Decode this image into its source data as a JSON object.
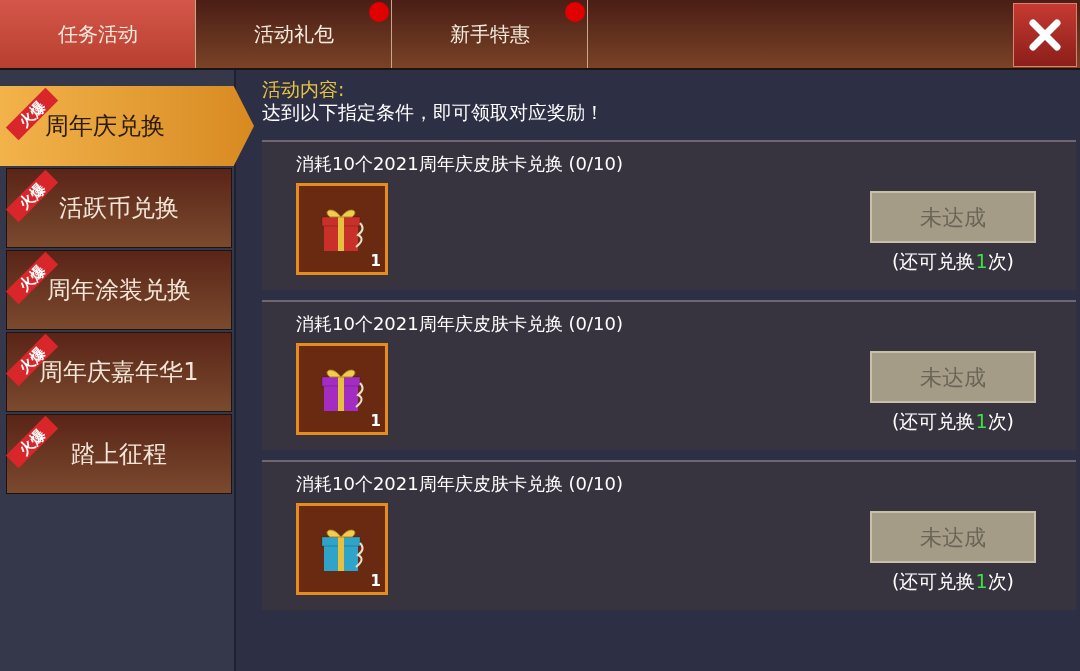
{
  "tabs": [
    {
      "label": "任务活动",
      "selected": true,
      "badge": false
    },
    {
      "label": "活动礼包",
      "selected": false,
      "badge": true
    },
    {
      "label": "新手特惠",
      "selected": false,
      "badge": true
    }
  ],
  "sidebar": {
    "items": [
      {
        "label": "周年庆兑换",
        "tag": "火爆",
        "selected": true
      },
      {
        "label": "活跃币兑换",
        "tag": "火爆",
        "selected": false
      },
      {
        "label": "周年涂装兑换",
        "tag": "火爆",
        "selected": false
      },
      {
        "label": "周年庆嘉年华1",
        "tag": "火爆",
        "selected": false
      },
      {
        "label": "踏上征程",
        "tag": "火爆",
        "selected": false
      }
    ]
  },
  "content": {
    "heading": "活动内容:",
    "description": "达到以下指定条件，即可领取对应奖励！",
    "rewards": [
      {
        "title": "消耗10个2021周年庆皮肤卡兑换  (0/10)",
        "item": {
          "color": "#c8302a",
          "count": "1"
        },
        "button": {
          "label": "未达成",
          "disabled": true
        },
        "remaining": {
          "prefix": "(还可兑换",
          "count": "1",
          "suffix": "次)"
        }
      },
      {
        "title": "消耗10个2021周年庆皮肤卡兑换  (0/10)",
        "item": {
          "color": "#a42cc0",
          "count": "1"
        },
        "button": {
          "label": "未达成",
          "disabled": true
        },
        "remaining": {
          "prefix": "(还可兑换",
          "count": "1",
          "suffix": "次)"
        }
      },
      {
        "title": "消耗10个2021周年庆皮肤卡兑换  (0/10)",
        "item": {
          "color": "#2fa3c8",
          "count": "1"
        },
        "button": {
          "label": "未达成",
          "disabled": true
        },
        "remaining": {
          "prefix": "(还可兑换",
          "count": "1",
          "suffix": "次)"
        }
      }
    ]
  }
}
